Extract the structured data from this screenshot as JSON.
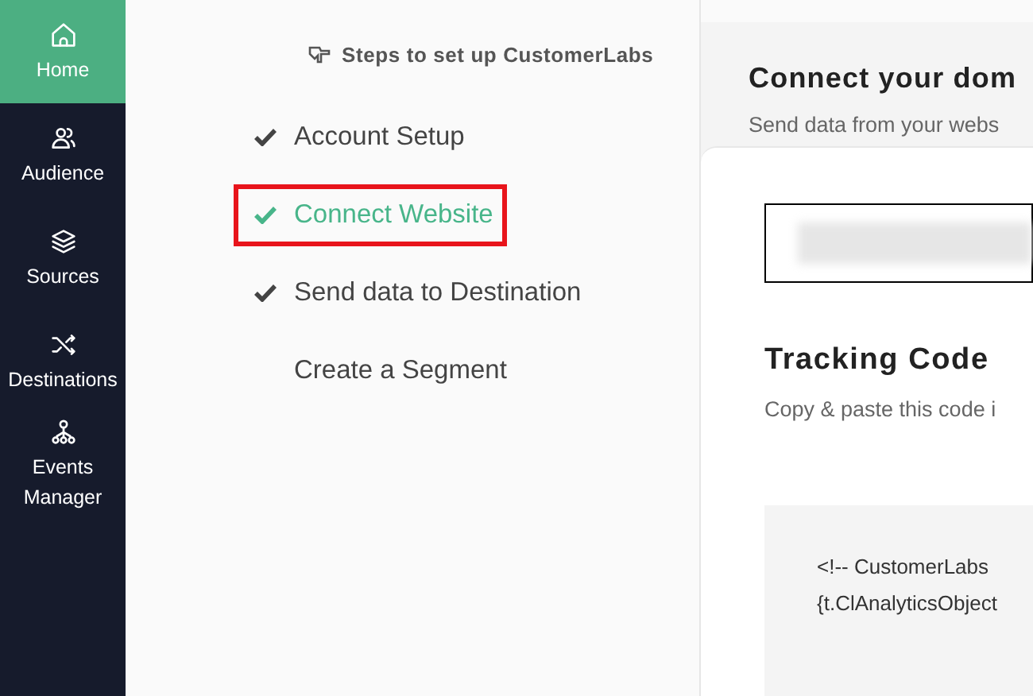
{
  "sidebar": {
    "items": [
      {
        "label": "Home",
        "selected": true
      },
      {
        "label": "Audience",
        "selected": false
      },
      {
        "label": "Sources",
        "selected": false
      },
      {
        "label": "Destinations",
        "selected": false
      },
      {
        "label": "Events Manager",
        "selected": false
      }
    ]
  },
  "steps": {
    "title": "Steps to set up CustomerLabs",
    "items": [
      {
        "label": "Account Setup",
        "done": true,
        "selected": false,
        "highlighted": false
      },
      {
        "label": "Connect Website",
        "done": true,
        "selected": true,
        "highlighted": true
      },
      {
        "label": "Send data to Destination",
        "done": true,
        "selected": false,
        "highlighted": false
      },
      {
        "label": "Create a Segment",
        "done": false,
        "selected": false,
        "highlighted": false
      }
    ]
  },
  "panel": {
    "title": "Connect your dom",
    "subtitle": "Send data from your webs",
    "tracking": {
      "title": "Tracking Code",
      "description": "Copy & paste this code i",
      "code_lines": [
        "<!-- CustomerLabs",
        "{t.ClAnalyticsObject"
      ]
    }
  }
}
